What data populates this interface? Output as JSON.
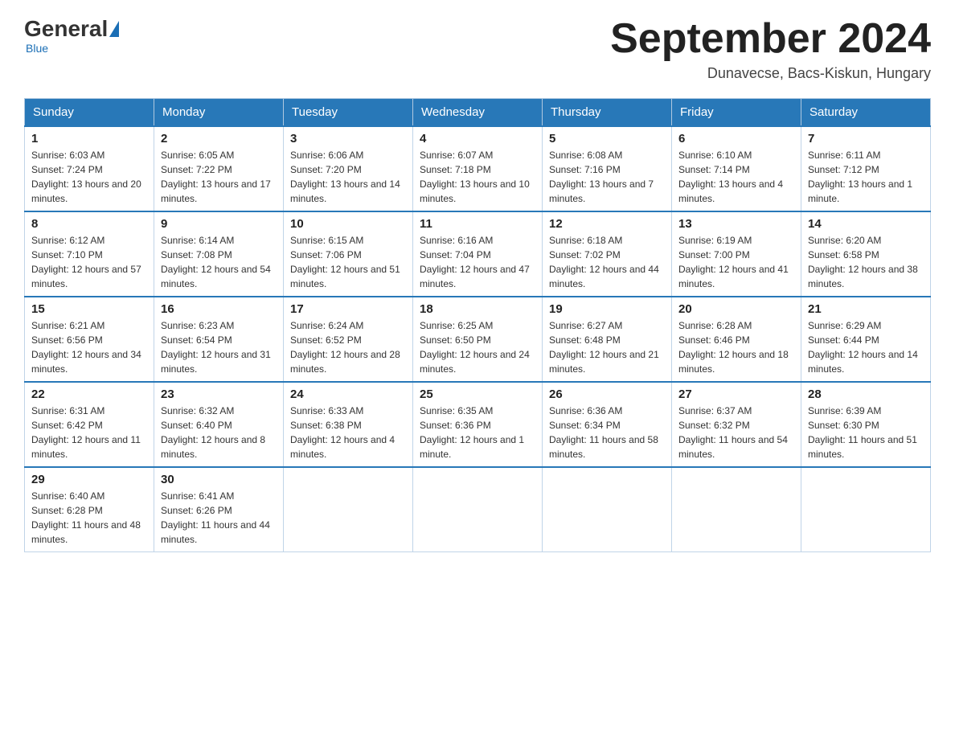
{
  "header": {
    "logo_general": "General",
    "logo_blue": "Blue",
    "month_title": "September 2024",
    "location": "Dunavecse, Bacs-Kiskun, Hungary"
  },
  "days_of_week": [
    "Sunday",
    "Monday",
    "Tuesday",
    "Wednesday",
    "Thursday",
    "Friday",
    "Saturday"
  ],
  "weeks": [
    [
      {
        "day": "1",
        "sunrise": "Sunrise: 6:03 AM",
        "sunset": "Sunset: 7:24 PM",
        "daylight": "Daylight: 13 hours and 20 minutes."
      },
      {
        "day": "2",
        "sunrise": "Sunrise: 6:05 AM",
        "sunset": "Sunset: 7:22 PM",
        "daylight": "Daylight: 13 hours and 17 minutes."
      },
      {
        "day": "3",
        "sunrise": "Sunrise: 6:06 AM",
        "sunset": "Sunset: 7:20 PM",
        "daylight": "Daylight: 13 hours and 14 minutes."
      },
      {
        "day": "4",
        "sunrise": "Sunrise: 6:07 AM",
        "sunset": "Sunset: 7:18 PM",
        "daylight": "Daylight: 13 hours and 10 minutes."
      },
      {
        "day": "5",
        "sunrise": "Sunrise: 6:08 AM",
        "sunset": "Sunset: 7:16 PM",
        "daylight": "Daylight: 13 hours and 7 minutes."
      },
      {
        "day": "6",
        "sunrise": "Sunrise: 6:10 AM",
        "sunset": "Sunset: 7:14 PM",
        "daylight": "Daylight: 13 hours and 4 minutes."
      },
      {
        "day": "7",
        "sunrise": "Sunrise: 6:11 AM",
        "sunset": "Sunset: 7:12 PM",
        "daylight": "Daylight: 13 hours and 1 minute."
      }
    ],
    [
      {
        "day": "8",
        "sunrise": "Sunrise: 6:12 AM",
        "sunset": "Sunset: 7:10 PM",
        "daylight": "Daylight: 12 hours and 57 minutes."
      },
      {
        "day": "9",
        "sunrise": "Sunrise: 6:14 AM",
        "sunset": "Sunset: 7:08 PM",
        "daylight": "Daylight: 12 hours and 54 minutes."
      },
      {
        "day": "10",
        "sunrise": "Sunrise: 6:15 AM",
        "sunset": "Sunset: 7:06 PM",
        "daylight": "Daylight: 12 hours and 51 minutes."
      },
      {
        "day": "11",
        "sunrise": "Sunrise: 6:16 AM",
        "sunset": "Sunset: 7:04 PM",
        "daylight": "Daylight: 12 hours and 47 minutes."
      },
      {
        "day": "12",
        "sunrise": "Sunrise: 6:18 AM",
        "sunset": "Sunset: 7:02 PM",
        "daylight": "Daylight: 12 hours and 44 minutes."
      },
      {
        "day": "13",
        "sunrise": "Sunrise: 6:19 AM",
        "sunset": "Sunset: 7:00 PM",
        "daylight": "Daylight: 12 hours and 41 minutes."
      },
      {
        "day": "14",
        "sunrise": "Sunrise: 6:20 AM",
        "sunset": "Sunset: 6:58 PM",
        "daylight": "Daylight: 12 hours and 38 minutes."
      }
    ],
    [
      {
        "day": "15",
        "sunrise": "Sunrise: 6:21 AM",
        "sunset": "Sunset: 6:56 PM",
        "daylight": "Daylight: 12 hours and 34 minutes."
      },
      {
        "day": "16",
        "sunrise": "Sunrise: 6:23 AM",
        "sunset": "Sunset: 6:54 PM",
        "daylight": "Daylight: 12 hours and 31 minutes."
      },
      {
        "day": "17",
        "sunrise": "Sunrise: 6:24 AM",
        "sunset": "Sunset: 6:52 PM",
        "daylight": "Daylight: 12 hours and 28 minutes."
      },
      {
        "day": "18",
        "sunrise": "Sunrise: 6:25 AM",
        "sunset": "Sunset: 6:50 PM",
        "daylight": "Daylight: 12 hours and 24 minutes."
      },
      {
        "day": "19",
        "sunrise": "Sunrise: 6:27 AM",
        "sunset": "Sunset: 6:48 PM",
        "daylight": "Daylight: 12 hours and 21 minutes."
      },
      {
        "day": "20",
        "sunrise": "Sunrise: 6:28 AM",
        "sunset": "Sunset: 6:46 PM",
        "daylight": "Daylight: 12 hours and 18 minutes."
      },
      {
        "day": "21",
        "sunrise": "Sunrise: 6:29 AM",
        "sunset": "Sunset: 6:44 PM",
        "daylight": "Daylight: 12 hours and 14 minutes."
      }
    ],
    [
      {
        "day": "22",
        "sunrise": "Sunrise: 6:31 AM",
        "sunset": "Sunset: 6:42 PM",
        "daylight": "Daylight: 12 hours and 11 minutes."
      },
      {
        "day": "23",
        "sunrise": "Sunrise: 6:32 AM",
        "sunset": "Sunset: 6:40 PM",
        "daylight": "Daylight: 12 hours and 8 minutes."
      },
      {
        "day": "24",
        "sunrise": "Sunrise: 6:33 AM",
        "sunset": "Sunset: 6:38 PM",
        "daylight": "Daylight: 12 hours and 4 minutes."
      },
      {
        "day": "25",
        "sunrise": "Sunrise: 6:35 AM",
        "sunset": "Sunset: 6:36 PM",
        "daylight": "Daylight: 12 hours and 1 minute."
      },
      {
        "day": "26",
        "sunrise": "Sunrise: 6:36 AM",
        "sunset": "Sunset: 6:34 PM",
        "daylight": "Daylight: 11 hours and 58 minutes."
      },
      {
        "day": "27",
        "sunrise": "Sunrise: 6:37 AM",
        "sunset": "Sunset: 6:32 PM",
        "daylight": "Daylight: 11 hours and 54 minutes."
      },
      {
        "day": "28",
        "sunrise": "Sunrise: 6:39 AM",
        "sunset": "Sunset: 6:30 PM",
        "daylight": "Daylight: 11 hours and 51 minutes."
      }
    ],
    [
      {
        "day": "29",
        "sunrise": "Sunrise: 6:40 AM",
        "sunset": "Sunset: 6:28 PM",
        "daylight": "Daylight: 11 hours and 48 minutes."
      },
      {
        "day": "30",
        "sunrise": "Sunrise: 6:41 AM",
        "sunset": "Sunset: 6:26 PM",
        "daylight": "Daylight: 11 hours and 44 minutes."
      },
      null,
      null,
      null,
      null,
      null
    ]
  ]
}
